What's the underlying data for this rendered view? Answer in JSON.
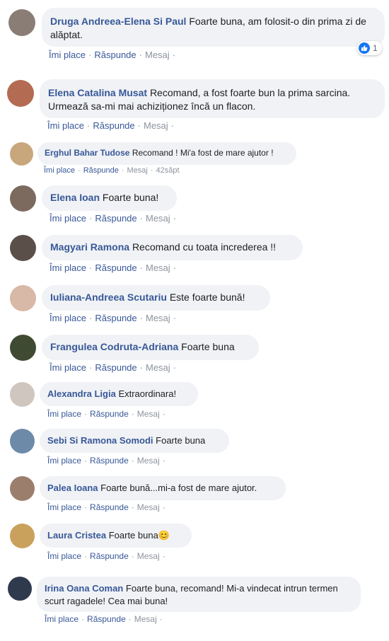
{
  "comments": [
    {
      "author": "Druga Andreea-Elena Si Paul",
      "text": "Foarte buna, am folosit-o din prima zi de alăptat.",
      "like": "Îmi place",
      "reply": "Răspunde",
      "message": "Mesaj",
      "reaction_count": "1",
      "avatar_color": "#8a7d75"
    },
    {
      "author": "Elena Catalina Musat",
      "text": "Recomand, a fost foarte bun la prima sarcina. Urmează sa-mi mai achiziționez încă un flacon.",
      "like": "Îmi place",
      "reply": "Răspunde",
      "message": "Mesaj",
      "avatar_color": "#b36b52"
    },
    {
      "author": "Erghul Bahar Tudose",
      "text": "Recomand ! Mi'a fost de mare ajutor !",
      "like": "Îmi place",
      "reply": "Răspunde",
      "message": "Mesaj",
      "time": "42săpt",
      "avatar_color": "#c9a77d"
    },
    {
      "author": "Elena Ioan",
      "text": "Foarte buna!",
      "like": "Îmi place",
      "reply": "Răspunde",
      "message": "Mesaj",
      "avatar_color": "#7c6a5e"
    },
    {
      "author": "Magyari Ramona",
      "text": "Recomand cu toata increderea !!",
      "like": "Îmi place",
      "reply": "Răspunde",
      "message": "Mesaj",
      "avatar_color": "#5b4f4a"
    },
    {
      "author": "Iuliana-Andreea Scutariu",
      "text": "Este foarte bună!",
      "like": "Îmi place",
      "reply": "Răspunde",
      "message": "Mesaj",
      "avatar_color": "#d8b8a6"
    },
    {
      "author": "Frangulea Codruta-Adriana",
      "text": "Foarte buna",
      "like": "Îmi place",
      "reply": "Răspunde",
      "message": "Mesaj",
      "avatar_color": "#3f4a33"
    },
    {
      "author": "Alexandra Ligia",
      "text": "Extraordinara!",
      "like": "Îmi place",
      "reply": "Răspunde",
      "message": "Mesaj",
      "avatar_color": "#cfc6c0"
    },
    {
      "author": "Sebi Si Ramona Somodi",
      "text": "Foarte buna",
      "like": "Îmi place",
      "reply": "Răspunde",
      "message": "Mesaj",
      "avatar_color": "#6d8aa8"
    },
    {
      "author": "Palea Ioana",
      "text": "Foarte bună...mi-a fost de mare ajutor.",
      "like": "Îmi place",
      "reply": "Răspunde",
      "message": "Mesaj",
      "avatar_color": "#9b7e6c"
    },
    {
      "author": "Laura Cristea",
      "text": "Foarte buna😊",
      "like": "Îmi place",
      "reply": "Răspunde",
      "message": "Mesaj",
      "avatar_color": "#c9a15c"
    },
    {
      "author": "Irina Oana Coman",
      "text": "Foarte buna, recomand! Mi-a vindecat intrun termen scurt ragadele! Cea mai buna!",
      "like": "Îmi place",
      "reply": "Răspunde",
      "message": "Mesaj",
      "avatar_color": "#2f3a4f"
    }
  ]
}
